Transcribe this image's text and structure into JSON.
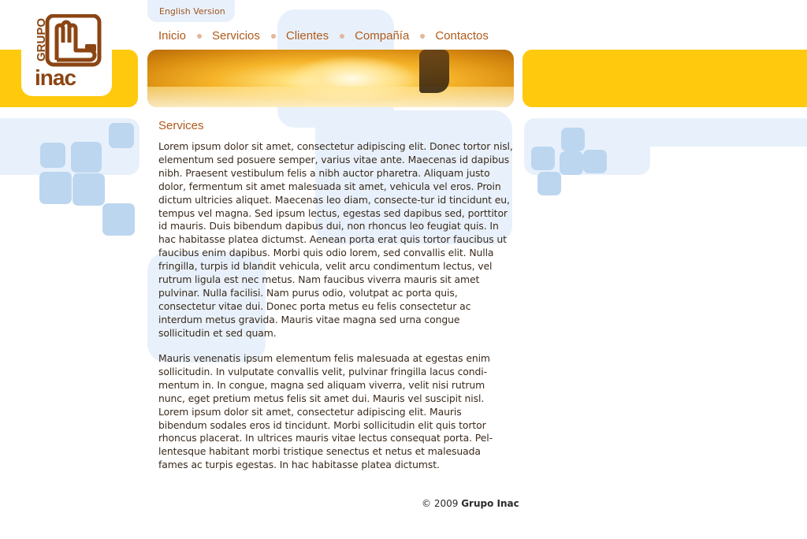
{
  "header": {
    "language_link": "English Version",
    "logo": {
      "top_text": "GRUPO",
      "bottom_text": "inac",
      "brand_color": "#8b4513"
    },
    "nav": [
      {
        "label": "Inicio"
      },
      {
        "label": "Servicios"
      },
      {
        "label": "Clientes"
      },
      {
        "label": "Compañía"
      },
      {
        "label": "Contactos"
      }
    ]
  },
  "main": {
    "title": "Services",
    "paragraphs": [
      "Lorem ipsum dolor sit amet, consectetur adipiscing elit. Donec tortor nisl, elementum sed posuere semper, varius vitae ante. Maecenas id dapibus nibh. Praesent vestibulum felis a nibh auctor pharetra. Aliquam justo dolor, fermentum sit amet malesuada sit amet, vehicula vel eros. Proin dictum ultricies aliquet. Maecenas leo diam, consecte-tur id tincidunt eu, tempus vel magna. Sed ipsum lectus, egestas sed dapibus sed, porttitor id mauris. Duis bibendum dapibus dui, non rhoncus leo feugiat quis. In hac habitasse platea dictumst. Aenean porta erat quis tortor faucibus ut faucibus enim dapibus. Morbi quis odio lorem, sed convallis elit. Nulla fringilla, turpis id blandit vehicula, velit arcu condimentum lectus, vel rutrum ligula est nec metus. Nam faucibus viverra mauris sit amet pulvinar. Nulla facilisi. Nam purus odio, volutpat ac porta quis, consectetur vitae dui. Donec porta metus eu felis consectetur ac interdum metus gravida. Mauris vitae magna sed urna congue sollicitudin et sed quam.",
      "Mauris venenatis ipsum elementum felis malesuada at egestas enim sollicitudin. In vulputate convallis velit, pulvinar fringilla lacus condi-mentum in. In congue, magna sed aliquam viverra, velit nisi rutrum nunc, eget pretium metus felis sit amet dui. Mauris vel suscipit nisl. Lorem ipsum dolor sit amet, consectetur adipiscing elit. Mauris bibendum sodales eros id tincidunt. Morbi sollicitudin elit quis tortor rhoncus placerat. In ultrices mauris vitae lectus consequat porta. Pel-lentesque habitant morbi tristique senectus et netus et malesuada fames ac turpis egestas. In hac habitasse platea dictumst."
    ]
  },
  "footer": {
    "copyright": "© 2009",
    "company": "Grupo Inac"
  },
  "colors": {
    "accent_yellow": "#ffc90d",
    "light_blue": "#e8f1fb",
    "square_blue": "#bcd6ef",
    "nav_text": "#b05a1c"
  }
}
